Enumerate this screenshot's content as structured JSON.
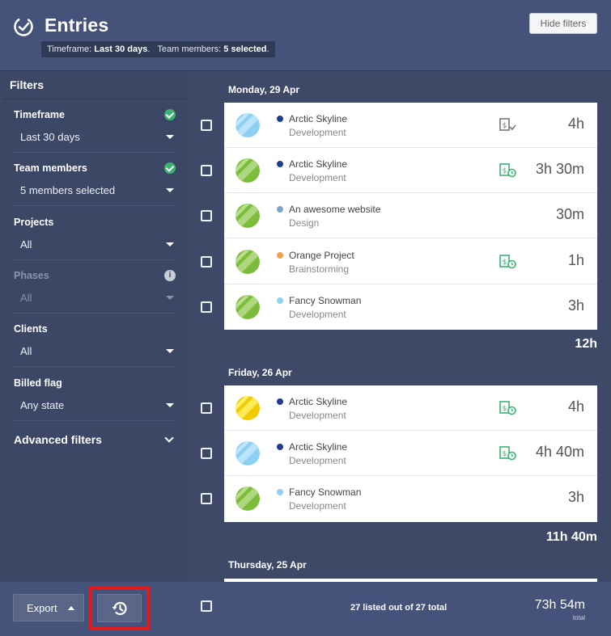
{
  "header": {
    "title": "Entries",
    "summary": {
      "timeframe_label": "Timeframe:",
      "timeframe_value": "Last 30 days",
      "team_label": "Team members:",
      "team_value": "5 selected"
    },
    "hide_filters_label": "Hide filters"
  },
  "sidebar": {
    "title": "Filters",
    "filters": [
      {
        "label": "Timeframe",
        "value": "Last 30 days",
        "status": "set"
      },
      {
        "label": "Team members",
        "value": "5 members selected",
        "status": "set"
      },
      {
        "label": "Projects",
        "value": "All",
        "status": "none"
      },
      {
        "label": "Phases",
        "value": "All",
        "status": "disabled"
      },
      {
        "label": "Clients",
        "value": "All",
        "status": "none"
      },
      {
        "label": "Billed flag",
        "value": "Any state",
        "status": "none"
      }
    ],
    "advanced_label": "Advanced filters"
  },
  "days": [
    {
      "label": "Monday, 29 Apr",
      "total": "12h",
      "entries": [
        {
          "project": "Arctic Skyline",
          "phase": "Development",
          "dot_color": "#1f3a93",
          "avatar": "blue",
          "bill_icon": "billed-check-icon",
          "duration": "4h"
        },
        {
          "project": "Arctic Skyline",
          "phase": "Development",
          "dot_color": "#1f3a93",
          "avatar": "green",
          "bill_icon": "billable-clock-icon",
          "duration": "3h 30m"
        },
        {
          "project": "An awesome website",
          "phase": "Design",
          "dot_color": "#7fa3c8",
          "avatar": "green",
          "bill_icon": "",
          "duration": "30m"
        },
        {
          "project": "Orange Project",
          "phase": "Brainstorming",
          "dot_color": "#f5a04a",
          "avatar": "green",
          "bill_icon": "billable-clock-icon",
          "duration": "1h"
        },
        {
          "project": "Fancy Snowman",
          "phase": "Development",
          "dot_color": "#8fd3f0",
          "avatar": "green",
          "bill_icon": "",
          "duration": "3h"
        }
      ]
    },
    {
      "label": "Friday, 26 Apr",
      "total": "11h 40m",
      "entries": [
        {
          "project": "Arctic Skyline",
          "phase": "Development",
          "dot_color": "#1f3a93",
          "avatar": "yellow",
          "bill_icon": "billable-clock-icon",
          "duration": "4h"
        },
        {
          "project": "Arctic Skyline",
          "phase": "Development",
          "dot_color": "#1f3a93",
          "avatar": "blue",
          "bill_icon": "billable-clock-icon",
          "duration": "4h 40m"
        },
        {
          "project": "Fancy Snowman",
          "phase": "Development",
          "dot_color": "#8fd3f0",
          "avatar": "green",
          "bill_icon": "",
          "duration": "3h"
        }
      ]
    },
    {
      "label": "Thursday, 25 Apr"
    }
  ],
  "footer": {
    "export_label": "Export",
    "history_icon": "history-icon",
    "count_text": "27 listed out of 27 total",
    "total": "73h 54m",
    "total_label": "total"
  },
  "colors": {
    "check_green": "#3cb371",
    "bill_green": "#3cb371",
    "highlight_red": "#e01b1b"
  }
}
